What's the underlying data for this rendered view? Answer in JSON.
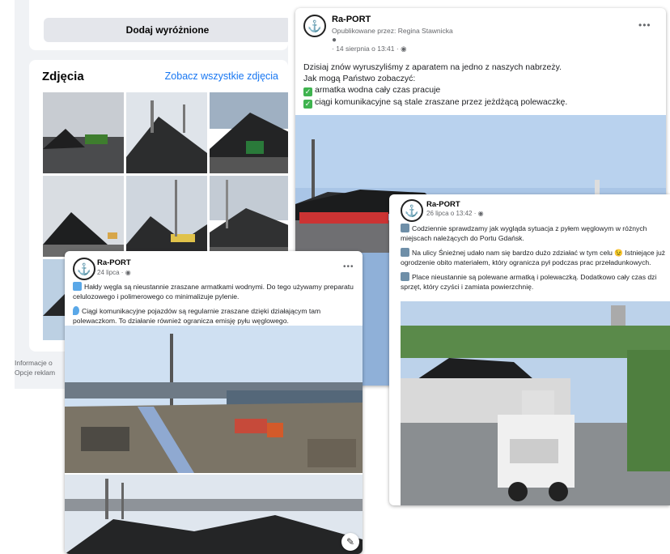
{
  "sidebar": {
    "featured_button": "Dodaj wyróżnione",
    "photos_title": "Zdjęcia",
    "photos_link": "Zobacz wszystkie zdjęcia",
    "footer_line1": "Informacje o",
    "footer_line2": "Opcje reklam"
  },
  "post_main": {
    "author": "Ra-PORT",
    "published_by": "Opublikowane przez: Regina Stawnicka",
    "date": "· 14 sierpnia o 13:41 ·",
    "text_line1": "Dzisiaj znów wyruszyliśmy z aparatem na jedno z naszych nabrzeży.",
    "text_line2": "Jak mogą Państwo zobaczyć:",
    "bullet1": "armatka wodna cały czas pracuje",
    "bullet2": "ciągi komunikacyjne są stale zraszane przez jeżdżącą polewaczkę."
  },
  "post_july24": {
    "author": "Ra-PORT",
    "date": "24 lipca ·",
    "para1": "Hałdy węgla są nieustannie zraszane armatkami wodnymi. Do tego używamy preparatu celulozowego i polimerowego co minimalizuje pylenie.",
    "para2": "Ciągi komunikacyjne pojazdów są regularnie zraszane dzięki działającym tam polewaczkom. To działanie również ogranicza emisję pyłu węglowego."
  },
  "post_july26": {
    "author": "Ra-PORT",
    "date": "26 lipca o 13:42 ·",
    "para1": "Codziennie sprawdzamy jak wygląda sytuacja z pyłem węglowym w różnych miejscach należących do Portu Gdańsk.",
    "para2": "Na ulicy Śnieżnej udało nam się bardzo dużo zdziałać w tym celu 😉 Istniejące już ogrodzenie obito materiałem, który ogranicza pył podczas prac przeładunkowych.",
    "para3": "Place nieustannie są polewane armatką i polewaczką. Dodatkowo cały czas dzi sprzęt, który czyści i zamiata powierzchnię."
  },
  "icons": {
    "logo": "anchor-logo-icon",
    "more": "more-options-icon",
    "globe": "globe-icon",
    "edit": "edit-icon"
  },
  "colors": {
    "link": "#1877f2",
    "meta": "#65676b",
    "button_bg": "#e4e6eb",
    "page_bg": "#f0f2f5"
  }
}
